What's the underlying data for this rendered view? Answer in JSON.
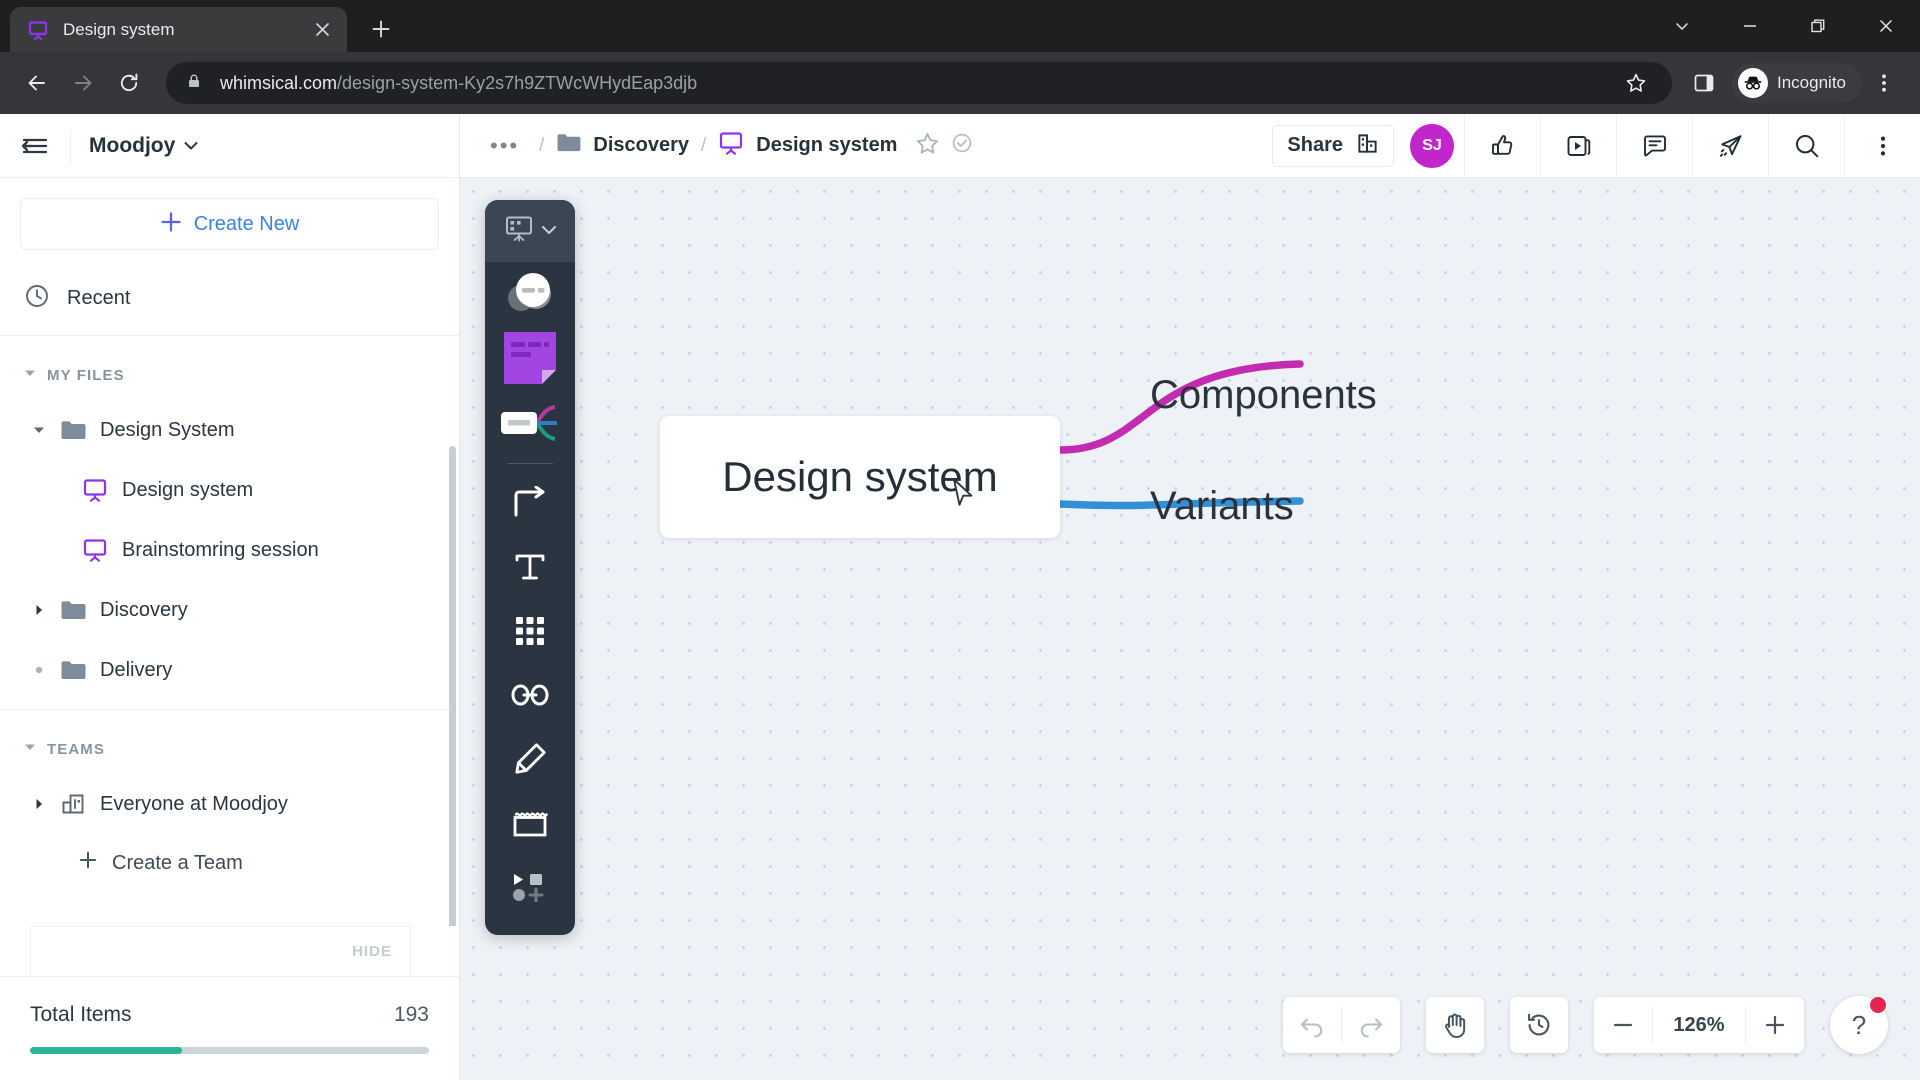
{
  "browser": {
    "tab": {
      "title": "Design system",
      "favicon": "whimsical-board-icon",
      "close": "×"
    },
    "new_tab_label": "+",
    "window_controls": {
      "tab_search": "tab-search-chevron",
      "minimize": "minimize",
      "maximize": "restore",
      "close": "close"
    },
    "nav": {
      "back": "back-arrow",
      "forward": "forward-arrow",
      "reload": "reload"
    },
    "omnibox": {
      "lock": "lock-icon",
      "url_domain": "whimsical.com",
      "url_path": "/design-system-Ky2s7h9ZTWcWHydEap3djb",
      "bookmark": "star-icon",
      "side_panel": "side-panel-icon"
    },
    "incognito_label": "Incognito",
    "menu": "chrome-menu-kebab"
  },
  "sidebar": {
    "collapse_icon": "collapse-sidebar-icon",
    "workspace": {
      "name": "Moodjoy",
      "caret": "⌄"
    },
    "create_new_label": "Create New",
    "recent_label": "Recent",
    "sections": [
      {
        "title": "MY FILES",
        "expanded": true
      },
      {
        "title": "TEAMS",
        "expanded": true
      }
    ],
    "my_files": [
      {
        "label": "Design System",
        "icon": "folder-icon",
        "twisty": "expanded",
        "level": 1
      },
      {
        "label": "Design system",
        "icon": "board-icon",
        "twisty": "none",
        "level": 2
      },
      {
        "label": "Brainstomring session",
        "icon": "board-icon",
        "twisty": "none",
        "level": 2
      },
      {
        "label": "Discovery",
        "icon": "folder-icon",
        "twisty": "collapsed",
        "level": 1
      },
      {
        "label": "Delivery",
        "icon": "folder-icon",
        "twisty": "dot",
        "level": 1
      }
    ],
    "teams": [
      {
        "label": "Everyone at Moodjoy",
        "icon": "team-building-icon",
        "twisty": "collapsed",
        "level": 1
      }
    ],
    "create_team_label": "Create a Team",
    "hide_label": "HIDE",
    "totals": {
      "label": "Total Items",
      "value": "193",
      "progress_percent": 38
    }
  },
  "app_topbar": {
    "breadcrumb": {
      "overflow": "•••",
      "separator": "/",
      "items": [
        {
          "label": "Discovery",
          "icon": "folder-icon"
        },
        {
          "label": "Design system",
          "icon": "board-icon"
        }
      ],
      "star": "star-outline-icon",
      "status": "saved-check-icon"
    },
    "share_label": "Share",
    "share_icon": "share-org-icon",
    "avatar_initials": "SJ",
    "actions": [
      {
        "name": "thumbs-up-icon"
      },
      {
        "name": "present-icon"
      },
      {
        "name": "comment-icon"
      },
      {
        "name": "send-icon"
      },
      {
        "name": "search-icon"
      },
      {
        "name": "more-kebab-icon"
      }
    ]
  },
  "tool_rail": {
    "header_icon": "board-type-icon",
    "header_caret": "⌄",
    "items": [
      {
        "name": "mind-map-tool"
      },
      {
        "name": "sticky-note-tool"
      },
      {
        "name": "flowchart-tool"
      },
      {
        "name": "connector-tool"
      },
      {
        "name": "text-tool"
      },
      {
        "name": "grid-table-tool"
      },
      {
        "name": "link-tool"
      },
      {
        "name": "draw-pencil-tool"
      },
      {
        "name": "frame-tool"
      },
      {
        "name": "shapes-more-tool"
      }
    ]
  },
  "canvas": {
    "root_node": {
      "text": "Design system"
    },
    "branches": [
      {
        "label": "Components",
        "color": "#c32bb0"
      },
      {
        "label": "Variants",
        "color": "#3490d6"
      }
    ],
    "controls": {
      "undo": "undo-icon",
      "redo": "redo-icon",
      "pan": "hand-pan-icon",
      "history": "version-history-icon",
      "zoom_out": "−",
      "zoom_level": "126%",
      "zoom_in": "+",
      "help": "?"
    }
  },
  "colors": {
    "accent_blue": "#3b82e4",
    "accent_purple": "#7b4fd4",
    "avatar_magenta": "#c026c9",
    "progress_green": "#2bb596",
    "branch_magenta": "#c32bb0",
    "branch_blue": "#3490d6",
    "notify_red": "#e3264f",
    "canvas_bg": "#eef1f5",
    "rail_bg": "#2a3541"
  }
}
